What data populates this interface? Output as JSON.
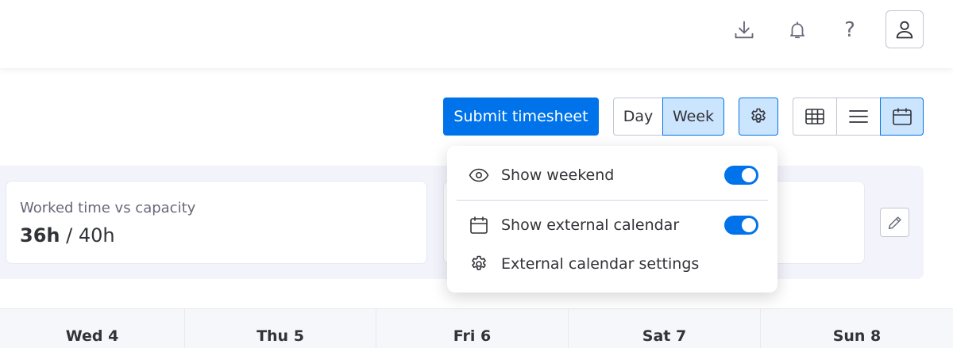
{
  "header": {
    "icons": [
      "download-icon",
      "bell-icon",
      "help-icon",
      "user-icon"
    ],
    "help_glyph": "?"
  },
  "toolbar": {
    "submit_label": "Submit timesheet",
    "view_mode": {
      "day_label": "Day",
      "week_label": "Week",
      "selected": "Week"
    },
    "layout_icons": [
      "grid-icon",
      "list-icon",
      "calendar-icon"
    ],
    "selected_layout": "calendar"
  },
  "settings_menu": {
    "items": [
      {
        "label": "Show weekend",
        "icon": "eye-icon",
        "toggle": true
      },
      {
        "label": "Show external calendar",
        "icon": "calendar-icon",
        "toggle": true
      },
      {
        "label": "External calendar settings",
        "icon": "gear-icon"
      }
    ]
  },
  "summary": {
    "worked_label": "Worked time vs capacity",
    "worked_value": "36h",
    "separator": " / ",
    "capacity_value": "40h"
  },
  "days": [
    "Wed 4",
    "Thu 5",
    "Fri 6",
    "Sat 7",
    "Sun 8"
  ],
  "colors": {
    "accent": "#0073ea",
    "accent_light": "#cce5ff",
    "panel_bg": "#f3f3fc",
    "text": "#323338",
    "muted_text": "#676879"
  }
}
